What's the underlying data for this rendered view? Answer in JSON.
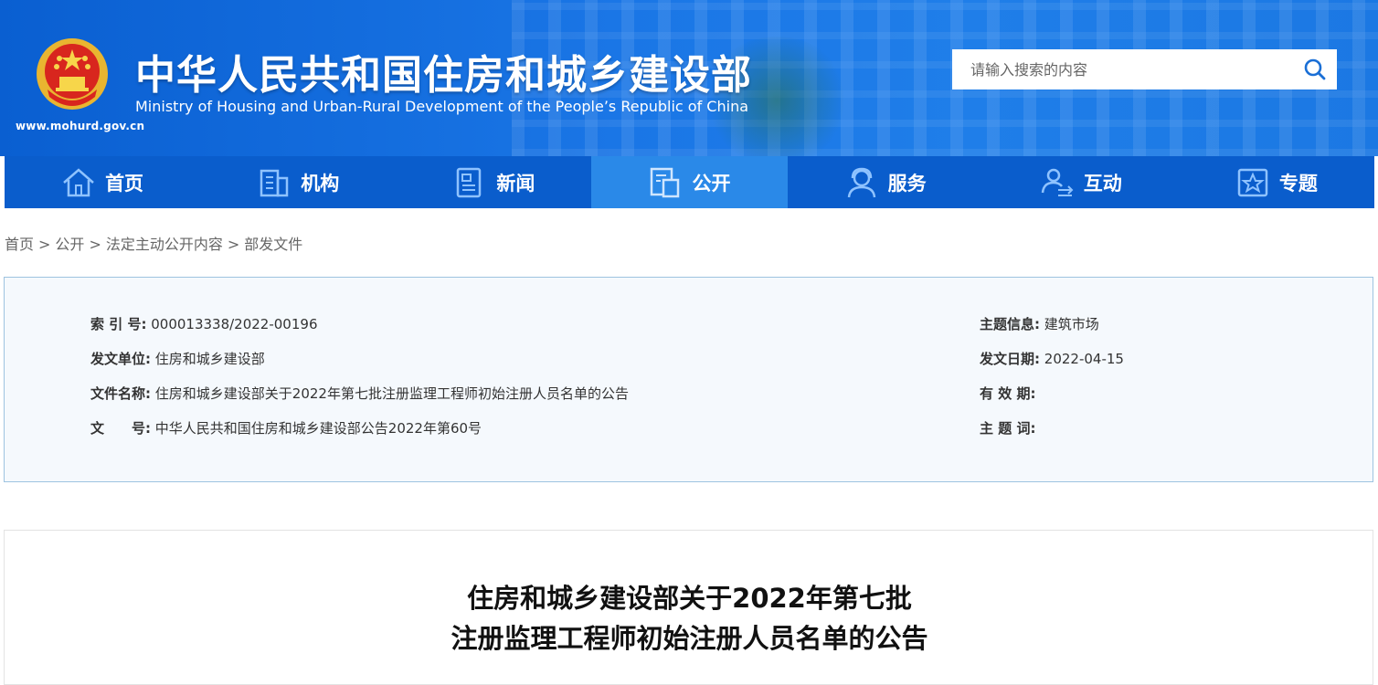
{
  "header": {
    "title_cn": "中华人民共和国住房和城乡建设部",
    "title_en": "Ministry of Housing and Urban-Rural Development of the People’s Republic of China",
    "site_url": "www.mohurd.gov.cn",
    "search_placeholder": "请输入搜索的内容"
  },
  "nav": {
    "items": [
      {
        "label": "首页",
        "icon": "home-icon"
      },
      {
        "label": "机构",
        "icon": "building-icon"
      },
      {
        "label": "新闻",
        "icon": "news-icon"
      },
      {
        "label": "公开",
        "icon": "document-icon",
        "active": true
      },
      {
        "label": "服务",
        "icon": "service-icon"
      },
      {
        "label": "互动",
        "icon": "interaction-icon"
      },
      {
        "label": "专题",
        "icon": "star-icon"
      }
    ]
  },
  "breadcrumb": {
    "items": [
      "首页",
      "公开",
      "法定主动公开内容",
      "部发文件"
    ],
    "separator": ">"
  },
  "info": {
    "index_label": "索 引 号:",
    "index_value": "000013338/2022-00196",
    "issuer_label": "发文单位:",
    "issuer_value": "住房和城乡建设部",
    "filename_label": "文件名称:",
    "filename_value": "住房和城乡建设部关于2022年第七批注册监理工程师初始注册人员名单的公告",
    "docno_label": "文　　号:",
    "docno_value": "中华人民共和国住房和城乡建设部公告2022年第60号",
    "subject_label": "主题信息:",
    "subject_value": "建筑市场",
    "date_label": "发文日期:",
    "date_value": "2022-04-15",
    "validity_label": "有 效 期:",
    "validity_value": "",
    "keywords_label": "主 题 词:",
    "keywords_value": ""
  },
  "article": {
    "title_line1": "住房和城乡建设部关于2022年第七批",
    "title_line2": "注册监理工程师初始注册人员名单的公告"
  },
  "colors": {
    "header_blue": "#1a76e6",
    "nav_blue": "#0a5dcc",
    "nav_active": "#2a89e8",
    "info_bg": "#f5f9fd",
    "info_border": "#9ec3e0"
  }
}
